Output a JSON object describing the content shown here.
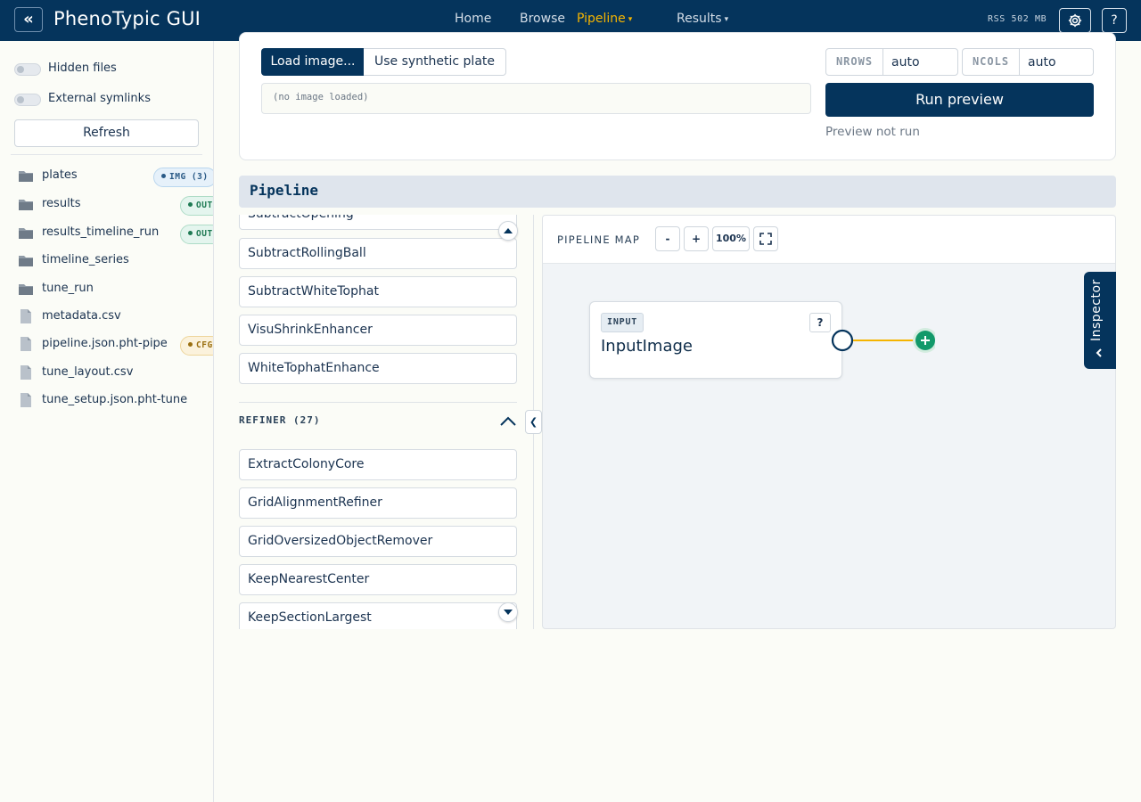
{
  "app": {
    "title": "PhenoTypic GUI",
    "collapse_glyph": "«"
  },
  "nav": {
    "items": [
      {
        "label": "Home"
      },
      {
        "label": "Browse"
      },
      {
        "label": "Pipeline",
        "caret": "▾"
      },
      {
        "label": "Results",
        "caret": "▾"
      }
    ],
    "active": "Pipeline"
  },
  "topbar": {
    "rss": "RSS 502 MB",
    "settings_icon": "gear-icon",
    "help_label": "?"
  },
  "sidebar": {
    "toggles": [
      {
        "label": "Hidden files",
        "on": false
      },
      {
        "label": "External symlinks",
        "on": false
      }
    ],
    "refresh_label": "Refresh",
    "files": [
      {
        "name": "plates",
        "kind": "folder",
        "badge": "IMG (3)",
        "badge_type": "img"
      },
      {
        "name": "results",
        "kind": "folder",
        "badge": "OUT",
        "badge_type": "out"
      },
      {
        "name": "results_timeline_run",
        "kind": "folder",
        "badge": "OUT",
        "badge_type": "out"
      },
      {
        "name": "timeline_series",
        "kind": "folder"
      },
      {
        "name": "tune_run",
        "kind": "folder"
      },
      {
        "name": "metadata.csv",
        "kind": "file"
      },
      {
        "name": "pipeline.json.pht-pipe",
        "kind": "file",
        "badge": "CFG",
        "badge_type": "cfg"
      },
      {
        "name": "tune_layout.csv",
        "kind": "file"
      },
      {
        "name": "tune_setup.json.pht-tune",
        "kind": "file"
      }
    ]
  },
  "preview": {
    "load_label": "Load image...",
    "synthetic_label": "Use synthetic plate",
    "image_status": "(no image loaded)",
    "nrows_label": "NROWS",
    "nrows_value": "auto",
    "ncols_label": "NCOLS",
    "ncols_value": "auto",
    "run_label": "Run preview",
    "status": "Preview not run"
  },
  "pipeline": {
    "title": "Pipeline",
    "palette_items_top": [
      "SubtractOpening",
      "SubtractRollingBall",
      "SubtractWhiteTophat",
      "VisuShrinkEnhancer",
      "WhiteTophatEnhance"
    ],
    "refiner_header": "REFINER (27)",
    "refiner_items": [
      "ExtractColonyCore",
      "GridAlignmentRefiner",
      "GridOversizedObjectRemover",
      "KeepNearestCenter",
      "KeepSectionLargest"
    ],
    "splitter_glyph": "❮",
    "map": {
      "title": "PIPELINE MAP",
      "zoom_out": "-",
      "zoom_in": "+",
      "zoom_level": "100%",
      "fullscreen_glyph": "⛶",
      "node": {
        "tag": "INPUT",
        "name": "InputImage",
        "help": "?"
      },
      "add_glyph": "+"
    },
    "inspector_label": "Inspector"
  },
  "colors": {
    "navy": "#05345c",
    "accent": "#f5b400",
    "add_node": "#12996a"
  }
}
